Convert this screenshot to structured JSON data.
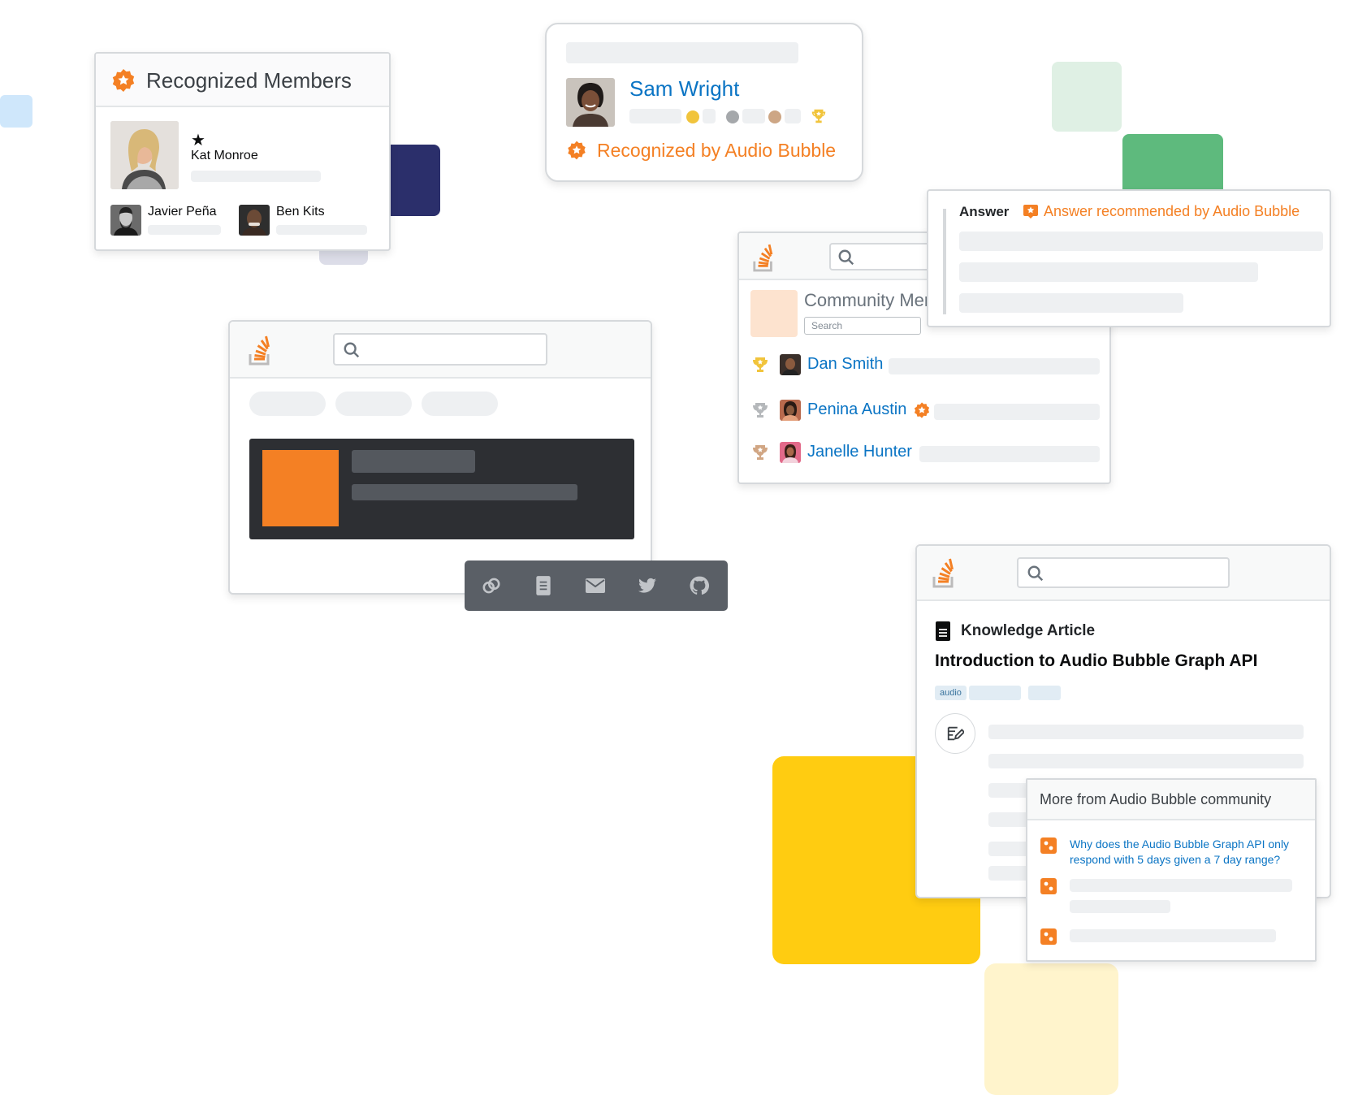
{
  "recognized_members": {
    "title": "Recognized Members",
    "featured": {
      "star": "★",
      "name": "Kat Monroe"
    },
    "others": [
      {
        "name": "Javier Peña"
      },
      {
        "name": "Ben Kits"
      }
    ]
  },
  "profile_card": {
    "name": "Sam Wright",
    "recognized_label": "Recognized by Audio Bubble"
  },
  "answer_card": {
    "label": "Answer",
    "recommended_label": "Answer recommended by Audio Bubble"
  },
  "community": {
    "title": "Community Mer",
    "search_placeholder": "Search",
    "members": [
      {
        "name": "Dan Smith",
        "trophy": "gold"
      },
      {
        "name": "Penina Austin",
        "trophy": "silver",
        "recognized": true
      },
      {
        "name": "Janelle Hunter",
        "trophy": "bronze"
      }
    ]
  },
  "share_toolbar": {
    "icons": [
      "link-icon",
      "document-icon",
      "mail-icon",
      "twitter-icon",
      "github-icon"
    ]
  },
  "article": {
    "type_label": "Knowledge Article",
    "title": "Introduction to Audio Bubble Graph API",
    "tag": "audio"
  },
  "more_from": {
    "title": "More from Audio Bubble community",
    "question": "Why does the Audio Bubble Graph API only respond with 5 days given a 7 day range?"
  },
  "colors": {
    "brand_orange": "#f48024",
    "link_blue": "#0a74c4",
    "navy": "#2b2f6b",
    "green": "#5eba7d",
    "yellow": "#ffcc11",
    "dark_panel": "#2d2f33"
  }
}
